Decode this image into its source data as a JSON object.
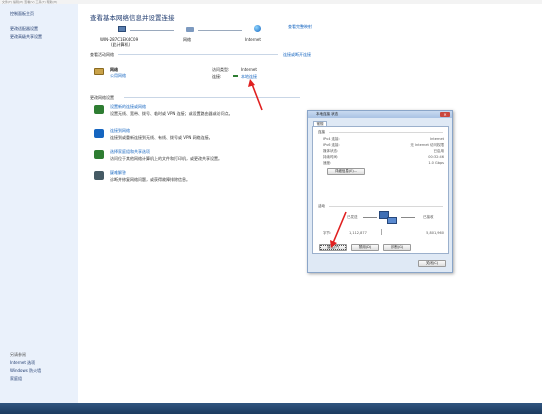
{
  "topmenu": {
    "text": "文件(F)  编辑(E)  查看(V)  工具(T)  帮助(H)"
  },
  "sidebar": {
    "home": "控制面板主页",
    "links": [
      "更改适配器设置",
      "更改高级共享设置"
    ],
    "see_also_title": "另请参阅",
    "see_also": [
      "Internet 选项",
      "Windows 防火墙",
      "家庭组"
    ]
  },
  "main": {
    "title": "查看基本网络信息并设置连接",
    "view_full_map": "查看完整映射",
    "map": {
      "computer_name": "WIN-287C1EK4C09",
      "computer_sub": "(此计算机)",
      "network_label": "网络",
      "internet_label": "Internet"
    },
    "active": {
      "section_title": "查看活动网络",
      "connect_disconnect": "连接或断开连接",
      "network_name": "网络",
      "network_type": "公用网络",
      "access_type_label": "访问类型:",
      "access_type_value": "Internet",
      "connections_label": "连接:",
      "connections_value": "本地连接"
    },
    "change": {
      "section_title": "更改网络设置",
      "tasks": [
        {
          "title": "设置新的连接或网络",
          "desc": "设置无线、宽带、拨号、临时或 VPN 连接；或设置路由器或访问点。",
          "color": "#2e7d32"
        },
        {
          "title": "连接到网络",
          "desc": "连接到或重新连接到无线、有线、拨号或 VPN 网络连接。",
          "color": "#1565c0"
        },
        {
          "title": "选择家庭组和共享选项",
          "desc": "访问位于其他网络计算机上的文件和打印机，或更改共享设置。",
          "color": "#2e7d32"
        },
        {
          "title": "疑难解答",
          "desc": "诊断并修复网络问题，或获得故障排除信息。",
          "color": "#455a64"
        }
      ]
    }
  },
  "dialog": {
    "title": "本地连接 状态",
    "close": "✕",
    "tab": "常规",
    "connection": {
      "title": "连接",
      "rows": [
        {
          "label": "IPv4 连接:",
          "value": "Internet"
        },
        {
          "label": "IPv6 连接:",
          "value": "无 Internet 访问权限"
        },
        {
          "label": "媒体状态:",
          "value": "已启用"
        },
        {
          "label": "持续时间:",
          "value": "00:32:46"
        },
        {
          "label": "速度:",
          "value": "1.0 Gbps"
        }
      ],
      "details_button": "详细信息(E)..."
    },
    "activity": {
      "title": "活动",
      "sent": "已发送",
      "received": "已接收",
      "bytes_label": "字节:",
      "sent_bytes": "1,112,877",
      "received_bytes": "5,801,960"
    },
    "buttons": {
      "properties": "属性(P)",
      "disable": "禁用(D)",
      "diagnose": "诊断(G)",
      "close": "关闭(C)"
    }
  }
}
